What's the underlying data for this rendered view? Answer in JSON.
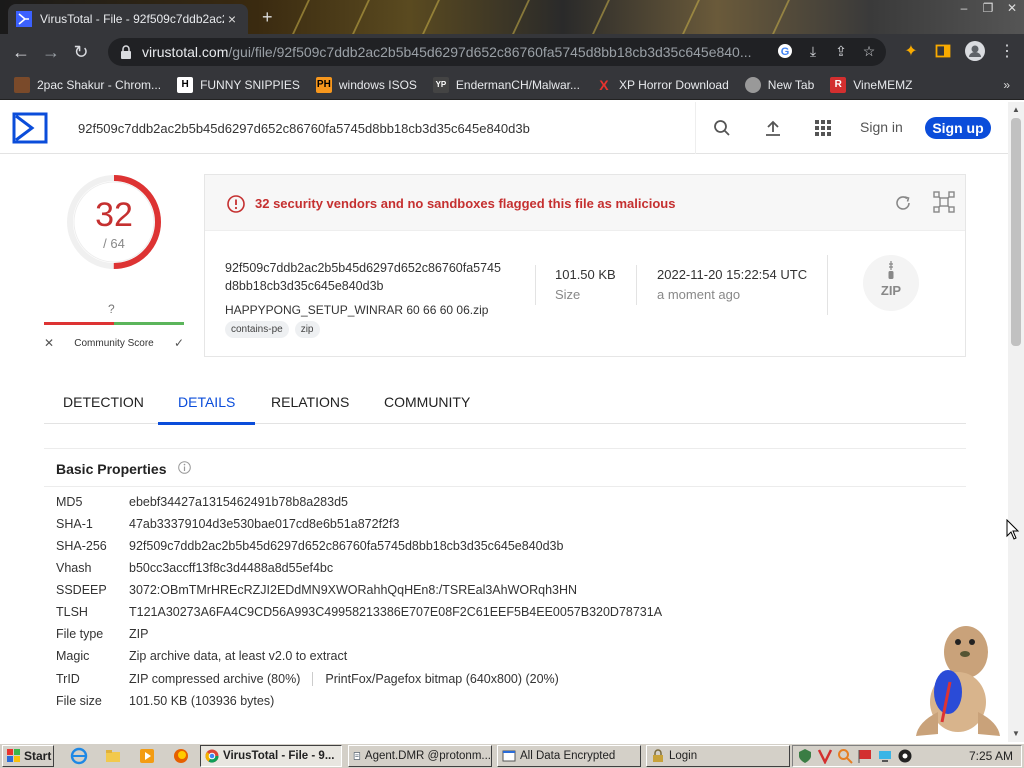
{
  "browser": {
    "tab_title": "VirusTotal - File - 92f509c7ddb2ac2",
    "tab_close": "×",
    "new_tab": "+",
    "url_host": "virustotal.com",
    "url_path": "/gui/file/92f509c7ddb2ac2b5b45d6297d652c86760fa5745d8bb18cb3d35c645e840...",
    "bookmarks": [
      {
        "label": "2pac Shakur - Chrom...",
        "icon": "2pac-favicon",
        "color": "#7a4a2a"
      },
      {
        "label": "FUNNY SNIPPIES",
        "icon": "H",
        "color": "#ffffff"
      },
      {
        "label": "windows ISOS",
        "icon": "PH",
        "color": "#f7971d"
      },
      {
        "label": "EndermanCH/Malwar...",
        "icon": "YP",
        "color": "#444444"
      },
      {
        "label": "XP Horror Download",
        "icon": "X",
        "color": "#e8332e"
      },
      {
        "label": "New Tab",
        "icon": "newtab-favicon",
        "color": "#999999"
      },
      {
        "label": "VineMEMZ",
        "icon": "R",
        "color": "#d32f2f"
      }
    ],
    "bookmarks_more": "»"
  },
  "vt": {
    "search_value": "92f509c7ddb2ac2b5b45d6297d652c86760fa5745d8bb18cb3d35c645e840d3b",
    "sign_in": "Sign in",
    "sign_up": "Sign up",
    "accent": "#0b4dda",
    "score": {
      "detections": "32",
      "total": "/ 64",
      "detected_fraction": 0.5
    },
    "community": {
      "value": "?",
      "label": "Community Score",
      "no": "✕",
      "yes": "✓"
    },
    "verdict": {
      "message": "32 security vendors and no sandboxes flagged this file as malicious",
      "color": "#c53030"
    },
    "file": {
      "hash_line1": "92f509c7ddb2ac2b5b45d6297d652c86760fa5745",
      "hash_line2": "d8bb18cb3d35c645e840d3b",
      "name": "HAPPYPONG_SETUP_WINRAR 60 66 60 06.zip",
      "tags": [
        "contains-pe",
        "zip"
      ],
      "size": "101.50 KB",
      "size_label": "Size",
      "date": "2022-11-20 15:22:54 UTC",
      "date_label": "a moment ago",
      "type_icon": "ZIP"
    },
    "tabs": [
      "DETECTION",
      "DETAILS",
      "RELATIONS",
      "COMMUNITY"
    ],
    "active_tab": "DETAILS",
    "basic_properties": {
      "title": "Basic Properties",
      "rows": [
        {
          "key": "MD5",
          "value": "ebebf34427a1315462491b78b8a283d5"
        },
        {
          "key": "SHA-1",
          "value": "47ab33379104d3e530bae017cd8e6b51a872f2f3"
        },
        {
          "key": "SHA-256",
          "value": "92f509c7ddb2ac2b5b45d6297d652c86760fa5745d8bb18cb3d35c645e840d3b"
        },
        {
          "key": "Vhash",
          "value": "b50cc3accff13f8c3d4488a8d55ef4bc"
        },
        {
          "key": "SSDEEP",
          "value": "3072:OBmTMrHREcRZJI2EDdMN9XWORahhQqHEn8:/TSREal3AhWORqh3HN"
        },
        {
          "key": "TLSH",
          "value": "T121A30273A6FA4C9CD56A993C49958213386E707E08F2C61EEF5B4EE0057B320D78731A"
        },
        {
          "key": "File type",
          "value": "ZIP"
        },
        {
          "key": "Magic",
          "value": "Zip archive data, at least v2.0 to extract"
        },
        {
          "key": "TrID",
          "value": "ZIP compressed archive (80%)",
          "value2": "PrintFox/Pagefox bitmap (640x800) (20%)"
        },
        {
          "key": "File size",
          "value": "101.50 KB (103936 bytes)"
        }
      ]
    }
  },
  "taskbar": {
    "start": "Start",
    "tasks": [
      {
        "label": "VirusTotal - File - 9...",
        "icon": "chrome-icon",
        "active": true
      },
      {
        "label": "Agent.DMR @protonm...",
        "icon": "notepad-icon",
        "active": false
      },
      {
        "label": "All Data Encrypted",
        "icon": "window-icon",
        "active": false
      },
      {
        "label": "Login",
        "icon": "lock-icon",
        "active": false
      }
    ],
    "clock": "7:25 AM"
  }
}
